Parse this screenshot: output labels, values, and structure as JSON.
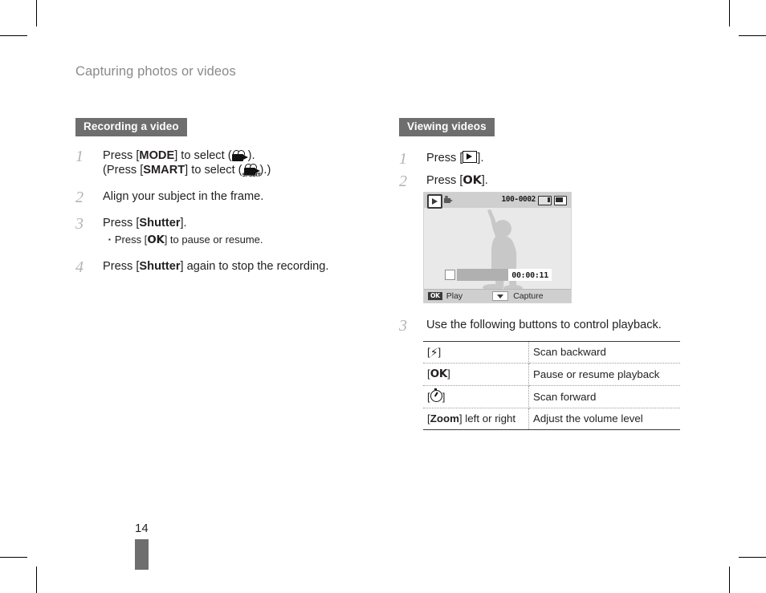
{
  "page": {
    "header": "Capturing photos or videos",
    "number": "14"
  },
  "left_column": {
    "section_label": "Recording a video",
    "steps": [
      {
        "num": "1",
        "text_a": "Press [",
        "key_a": "MODE",
        "text_b": "] to select (",
        "icon_a": "movie-mode-icon",
        "text_c": ").",
        "line2_a": "(Press [",
        "line2_key": "SMART",
        "line2_b": "] to select (",
        "line2_icon": "smart-movie-mode-icon",
        "line2_c": ").)"
      },
      {
        "num": "2",
        "text": "Align your subject in the frame."
      },
      {
        "num": "3",
        "text_a": "Press [",
        "key_a": "Shutter",
        "text_b": "].",
        "sub_a": "Press [",
        "sub_key": "OK",
        "sub_b": "] to pause or resume."
      },
      {
        "num": "4",
        "text_a": "Press [",
        "key_a": "Shutter",
        "text_b": "] again to stop the recording."
      }
    ]
  },
  "right_column": {
    "section_label": "Viewing videos",
    "steps": [
      {
        "num": "1",
        "text_a": "Press [",
        "icon": "play-button-icon",
        "text_b": "]."
      },
      {
        "num": "2",
        "text_a": "Press [",
        "key_a": "OK",
        "text_b": "]."
      },
      {
        "num": "3",
        "text": "Use the following buttons to control playback."
      }
    ],
    "lcd": {
      "file_number": "100-0002",
      "play_badge": "play-mode-icon",
      "movie_icon": "movie-file-icon",
      "card_icon": "memory-card-icon",
      "battery_icon": "battery-icon",
      "elapsed_time": "00:00:11",
      "ok_chip": "OK",
      "play_label": "Play",
      "down_chip": "down-arrow-icon",
      "capture_label": "Capture"
    },
    "control_table": {
      "rows": [
        {
          "button_prefix": "[",
          "button_icon": "flash-button-icon",
          "button_suffix": "]",
          "action": "Scan backward"
        },
        {
          "button_prefix": "[",
          "button_key": "OK",
          "button_suffix": "]",
          "action": "Pause or resume playback"
        },
        {
          "button_prefix": "[",
          "button_icon": "timer-button-icon",
          "button_suffix": "]",
          "action": "Scan forward"
        },
        {
          "button_prefix": "[",
          "button_key": "Zoom",
          "button_suffix": "] left or right",
          "action": "Adjust the volume level"
        }
      ]
    }
  },
  "colors": {
    "label_bg": "#6e6e6e",
    "step_number": "#b3b3b3",
    "header_text": "#8a8a8a",
    "body_text": "#231f20"
  }
}
